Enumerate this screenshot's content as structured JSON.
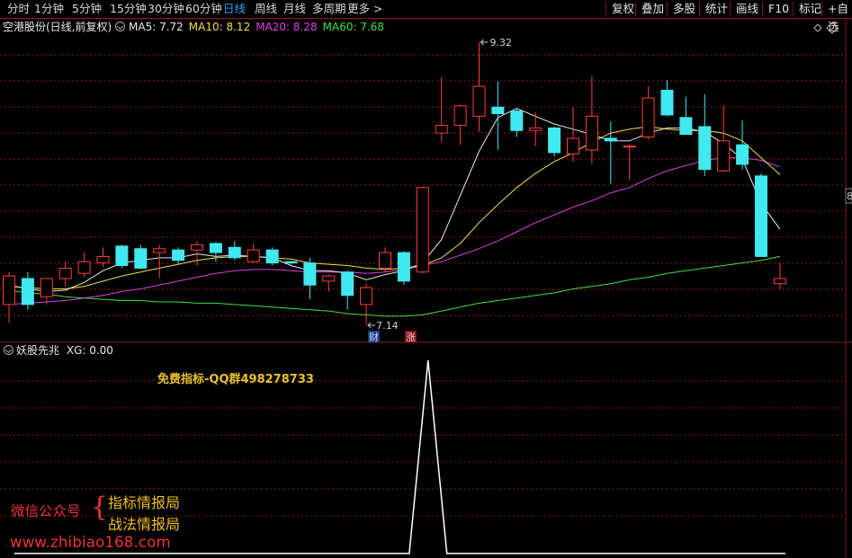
{
  "toolbar": {
    "periods": [
      "分时",
      "1分钟",
      "5分钟",
      "15分钟",
      "30分钟",
      "60分钟",
      "日线",
      "周线",
      "月线",
      "多周期",
      "更多"
    ],
    "active_period": "日线",
    "right_buttons": [
      "复权",
      "叠加",
      "多股",
      "统计",
      "画线",
      "F10",
      "标记",
      "+自选"
    ],
    "more_arrow": ">"
  },
  "info": {
    "title": "空港股份(日线,前复权)",
    "indicators": [
      {
        "label": "MA5:",
        "value": "7.72",
        "color": "#e8e8e8"
      },
      {
        "label": "MA10:",
        "value": "8.12",
        "color": "#f0e040"
      },
      {
        "label": "MA20:",
        "value": "8.28",
        "color": "#e040e0"
      },
      {
        "label": "MA60:",
        "value": "7.68",
        "color": "#40e040"
      }
    ]
  },
  "colors": {
    "up": "#ff3c3c",
    "down": "#40e8f0",
    "ma5": "#e8e8e8",
    "ma10": "#f0e040",
    "ma20": "#e040e0",
    "ma60": "#40e040",
    "grid": "#8b1a1a",
    "xg_line": "#ffffff"
  },
  "chart_data": {
    "type": "candlestick",
    "price_range": [
      7.0,
      9.6
    ],
    "high_marker": "9.32",
    "low_marker": "7.14",
    "candles": [
      {
        "o": 7.3,
        "h": 7.55,
        "l": 7.16,
        "c": 7.52
      },
      {
        "o": 7.5,
        "h": 7.55,
        "l": 7.26,
        "c": 7.3
      },
      {
        "o": 7.36,
        "h": 7.5,
        "l": 7.3,
        "c": 7.5
      },
      {
        "o": 7.5,
        "h": 7.63,
        "l": 7.44,
        "c": 7.58
      },
      {
        "o": 7.54,
        "h": 7.7,
        "l": 7.51,
        "c": 7.63
      },
      {
        "o": 7.62,
        "h": 7.74,
        "l": 7.59,
        "c": 7.67
      },
      {
        "o": 7.75,
        "h": 7.76,
        "l": 7.58,
        "c": 7.6
      },
      {
        "o": 7.73,
        "h": 7.76,
        "l": 7.57,
        "c": 7.58
      },
      {
        "o": 7.7,
        "h": 7.76,
        "l": 7.5,
        "c": 7.73
      },
      {
        "o": 7.72,
        "h": 7.74,
        "l": 7.61,
        "c": 7.64
      },
      {
        "o": 7.72,
        "h": 7.79,
        "l": 7.6,
        "c": 7.76
      },
      {
        "o": 7.77,
        "h": 7.78,
        "l": 7.63,
        "c": 7.7
      },
      {
        "o": 7.74,
        "h": 7.79,
        "l": 7.64,
        "c": 7.66
      },
      {
        "o": 7.63,
        "h": 7.77,
        "l": 7.62,
        "c": 7.72
      },
      {
        "o": 7.72,
        "h": 7.74,
        "l": 7.6,
        "c": 7.62
      },
      {
        "o": 7.63,
        "h": 7.63,
        "l": 7.61,
        "c": 7.62
      },
      {
        "o": 7.62,
        "h": 7.66,
        "l": 7.34,
        "c": 7.45
      },
      {
        "o": 7.48,
        "h": 7.53,
        "l": 7.4,
        "c": 7.52
      },
      {
        "o": 7.55,
        "h": 7.56,
        "l": 7.26,
        "c": 7.37
      },
      {
        "o": 7.3,
        "h": 7.46,
        "l": 7.14,
        "c": 7.43
      },
      {
        "o": 7.58,
        "h": 7.74,
        "l": 7.55,
        "c": 7.7
      },
      {
        "o": 7.7,
        "h": 7.71,
        "l": 7.45,
        "c": 7.48
      },
      {
        "o": 7.55,
        "h": 8.21,
        "l": 7.54,
        "c": 8.2
      },
      {
        "o": 8.62,
        "h": 9.05,
        "l": 8.55,
        "c": 8.68
      },
      {
        "o": 8.68,
        "h": 8.84,
        "l": 8.53,
        "c": 8.83
      },
      {
        "o": 8.75,
        "h": 9.32,
        "l": 8.63,
        "c": 8.98
      },
      {
        "o": 8.82,
        "h": 9.02,
        "l": 8.49,
        "c": 8.77
      },
      {
        "o": 8.79,
        "h": 8.81,
        "l": 8.59,
        "c": 8.64
      },
      {
        "o": 8.64,
        "h": 8.78,
        "l": 8.52,
        "c": 8.66
      },
      {
        "o": 8.66,
        "h": 8.67,
        "l": 8.44,
        "c": 8.47
      },
      {
        "o": 8.46,
        "h": 8.82,
        "l": 8.4,
        "c": 8.58
      },
      {
        "o": 8.49,
        "h": 9.06,
        "l": 8.38,
        "c": 8.75
      },
      {
        "o": 8.58,
        "h": 8.71,
        "l": 8.23,
        "c": 8.56
      },
      {
        "o": 8.52,
        "h": 8.53,
        "l": 8.26,
        "c": 8.52
      },
      {
        "o": 8.59,
        "h": 8.98,
        "l": 8.57,
        "c": 8.89
      },
      {
        "o": 8.95,
        "h": 9.03,
        "l": 8.75,
        "c": 8.76
      },
      {
        "o": 8.74,
        "h": 8.9,
        "l": 8.66,
        "c": 8.61
      },
      {
        "o": 8.67,
        "h": 8.92,
        "l": 8.29,
        "c": 8.34
      },
      {
        "o": 8.33,
        "h": 8.83,
        "l": 8.32,
        "c": 8.56
      },
      {
        "o": 8.53,
        "h": 8.72,
        "l": 8.34,
        "c": 8.38
      },
      {
        "o": 8.29,
        "h": 8.31,
        "l": 7.88,
        "c": 7.67
      },
      {
        "o": 7.46,
        "h": 7.62,
        "l": 7.42,
        "c": 7.5
      }
    ],
    "ma5": [
      7.45,
      7.42,
      7.4,
      7.41,
      7.47,
      7.56,
      7.62,
      7.64,
      7.66,
      7.66,
      7.69,
      7.67,
      7.68,
      7.67,
      7.66,
      7.6,
      7.56,
      7.56,
      7.54,
      7.49,
      7.53,
      7.56,
      7.62,
      7.8,
      8.14,
      8.48,
      8.74,
      8.81,
      8.75,
      8.69,
      8.65,
      8.61,
      8.56,
      8.56,
      8.62,
      8.66,
      8.66,
      8.63,
      8.54,
      8.42,
      8.08,
      7.88
    ],
    "ma10": [
      7.44,
      7.43,
      7.42,
      7.42,
      7.44,
      7.48,
      7.52,
      7.55,
      7.58,
      7.61,
      7.64,
      7.66,
      7.67,
      7.67,
      7.66,
      7.65,
      7.62,
      7.61,
      7.6,
      7.58,
      7.57,
      7.58,
      7.6,
      7.66,
      7.77,
      7.93,
      8.07,
      8.2,
      8.31,
      8.4,
      8.47,
      8.55,
      8.62,
      8.65,
      8.67,
      8.65,
      8.64,
      8.64,
      8.62,
      8.56,
      8.43,
      8.3
    ],
    "ma20": [
      7.3,
      7.31,
      7.32,
      7.33,
      7.35,
      7.37,
      7.4,
      7.42,
      7.45,
      7.48,
      7.51,
      7.54,
      7.56,
      7.57,
      7.57,
      7.56,
      7.55,
      7.55,
      7.55,
      7.54,
      7.55,
      7.57,
      7.6,
      7.63,
      7.68,
      7.73,
      7.79,
      7.86,
      7.93,
      7.99,
      8.05,
      8.1,
      8.16,
      8.2,
      8.27,
      8.33,
      8.37,
      8.41,
      8.43,
      8.43,
      8.41,
      8.36
    ],
    "ma60": [
      7.41,
      7.39,
      7.38,
      7.36,
      7.35,
      7.34,
      7.33,
      7.33,
      7.32,
      7.32,
      7.31,
      7.31,
      7.3,
      7.29,
      7.28,
      7.27,
      7.26,
      7.25,
      7.23,
      7.22,
      7.21,
      7.21,
      7.22,
      7.25,
      7.28,
      7.31,
      7.33,
      7.35,
      7.37,
      7.39,
      7.42,
      7.44,
      7.46,
      7.49,
      7.51,
      7.54,
      7.56,
      7.58,
      7.6,
      7.62,
      7.64,
      7.67
    ]
  },
  "markers": {
    "cai_label": "财",
    "zhang_label": "涨",
    "right_edge_label": "8"
  },
  "indicator": {
    "name": "妖股先兆",
    "xg_label": "XG: 0.00",
    "signals": [
      0,
      0,
      0,
      0,
      0,
      0,
      0,
      0,
      0,
      0,
      0,
      0,
      0,
      0,
      0,
      0,
      0,
      0,
      0,
      0,
      0,
      0,
      1,
      0,
      0,
      0,
      0,
      0,
      0,
      0,
      0,
      0,
      0,
      0,
      0,
      0,
      0,
      0,
      0,
      0,
      0,
      0
    ]
  },
  "watermark": {
    "qq": "免费指标-QQ群498278733",
    "wechat": "微信公众号",
    "brace": "{",
    "items": [
      "指标情报局",
      "战法情报局"
    ],
    "url": "www.zhibiao168.com"
  }
}
